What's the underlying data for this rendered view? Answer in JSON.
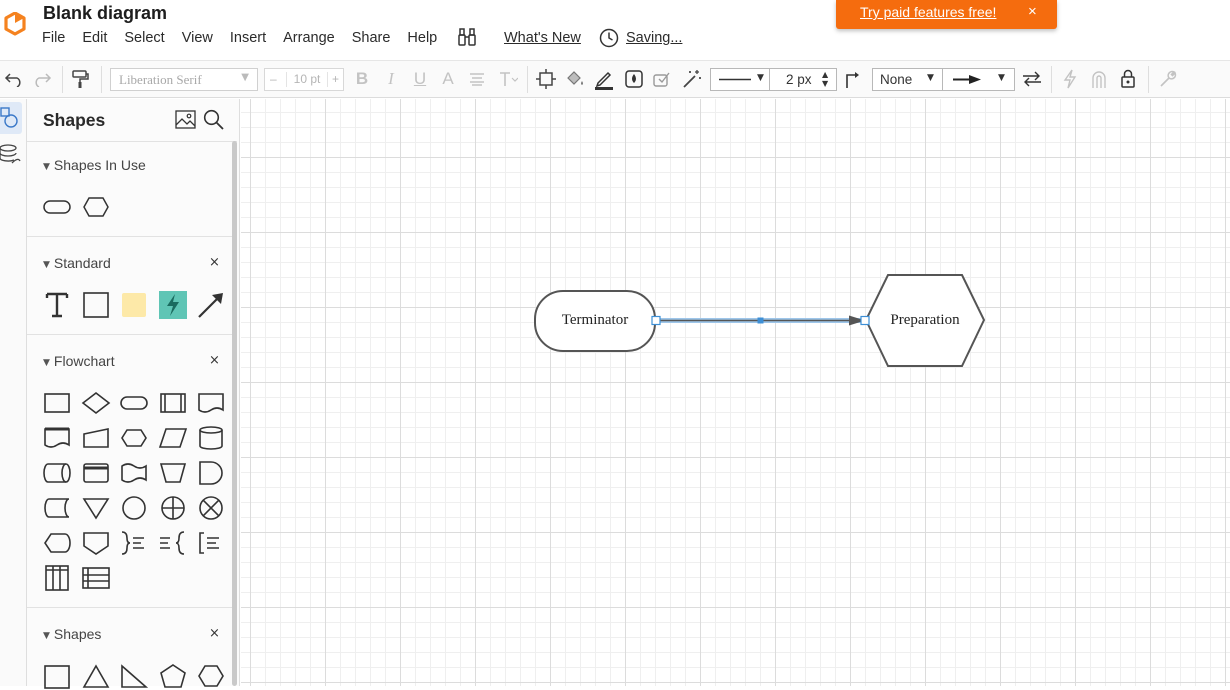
{
  "app": {
    "document_title": "Blank diagram",
    "menu": [
      "File",
      "Edit",
      "Select",
      "View",
      "Insert",
      "Arrange",
      "Share",
      "Help"
    ],
    "whats_new": "What's New",
    "save_status": "Saving...",
    "promo": {
      "text": "Try paid features free!",
      "close": "×",
      "color": "#f56c0e"
    }
  },
  "toolbar": {
    "font_family": "Liberation Serif",
    "font_size": "10 pt",
    "font_size_minus": "–",
    "font_size_plus": "+",
    "line_width": "2 px",
    "arrow_start": "None",
    "icons": [
      "undo-icon",
      "redo-icon",
      "format-painter-icon",
      "bold-icon",
      "italic-icon",
      "underline-icon",
      "text-color-icon",
      "align-icon",
      "text-options-icon",
      "shape-select-icon",
      "fill-bucket-icon",
      "line-color-icon",
      "opacity-icon",
      "shadow-icon",
      "magic-wand-icon",
      "elbow-line-icon",
      "swap-arrows-icon",
      "lightning-icon",
      "magnet-icon",
      "lock-icon",
      "wrench-icon"
    ]
  },
  "panel": {
    "title": "Shapes",
    "sections": {
      "in_use": {
        "title": "Shapes In Use"
      },
      "standard": {
        "title": "Standard",
        "close": "×"
      },
      "flowchart": {
        "title": "Flowchart",
        "close": "×"
      },
      "shapes": {
        "title": "Shapes",
        "close": "×"
      }
    },
    "accent_color": "#dfe9f7",
    "note_color": "#fde9a8",
    "action_color": "#5fc5b5"
  },
  "canvas": {
    "nodes": [
      {
        "id": "terminator",
        "shape": "terminator",
        "label": "Terminator"
      },
      {
        "id": "preparation",
        "shape": "hexagon",
        "label": "Preparation"
      }
    ],
    "connector": {
      "from": "terminator",
      "to": "preparation",
      "selected": true,
      "selection_color": "#3d8fd6"
    }
  }
}
